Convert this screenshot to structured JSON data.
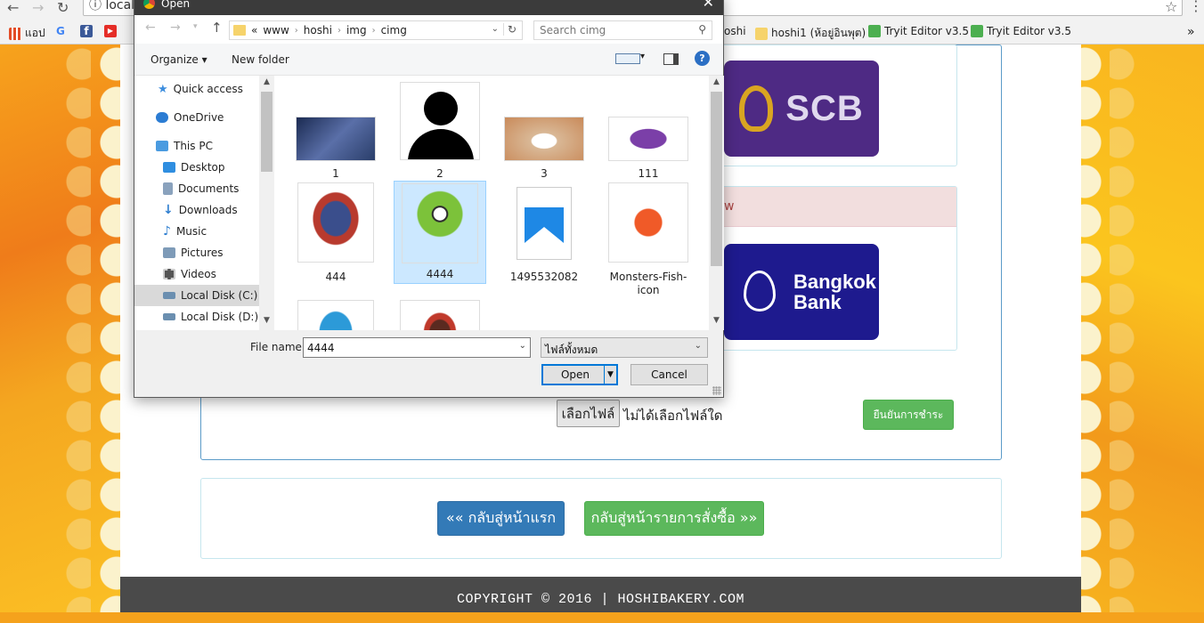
{
  "browser": {
    "address_text": "local",
    "back_glyph": "←",
    "forward_glyph": "→",
    "reload_glyph": "↻",
    "info_glyph": "ⓘ",
    "star_glyph": "☆",
    "menu_glyph": "⋮",
    "bookmarks": [
      {
        "label": "แอป",
        "icon": "apps-icon",
        "color": "#e34c26"
      },
      {
        "label": "G",
        "icon": "google-icon",
        "color": "#4285f4"
      },
      {
        "label": "f",
        "icon": "facebook-icon",
        "color": "#3b5998"
      },
      {
        "label": "▶",
        "icon": "youtube-icon",
        "color": "#e52d27"
      },
      {
        "label": "oshi",
        "icon": "",
        "color": ""
      },
      {
        "label": "hoshi1 (ห้อยู่อินพุต)",
        "icon": "folder-icon",
        "color": "#f6d36b"
      },
      {
        "label": "Tryit Editor v3.5",
        "icon": "w3schools-icon",
        "color": "#4caf50"
      },
      {
        "label": "Tryit Editor v3.5",
        "icon": "w3schools-icon",
        "color": "#4caf50"
      }
    ],
    "more_bookmarks_glyph": "»"
  },
  "page": {
    "banks": [
      {
        "name": "SCB",
        "color": "#4e2a84"
      },
      {
        "name_line1": "Bangkok",
        "name_line2": "Bank",
        "color": "#1e1a8e"
      }
    ],
    "alert_fragment": "w",
    "alert_color": "#f2dede",
    "file_button_label": "เลือกไฟล์",
    "no_file_label": "ไม่ได้เลือกไฟล์ใด",
    "confirm_button_label": "ยืนยันการชำระ",
    "back_home_button_label": "«« กลับสู่หน้าแรก",
    "back_orders_button_label": "กลับสู่หน้ารายการสั่งซื้อ »»",
    "primary_color": "#337ab7",
    "success_color": "#5cb85c",
    "footer_text": "COPYRIGHT © 2016 | HOSHIBAKERY.COM"
  },
  "dialog": {
    "title": "Open",
    "close_glyph": "✕",
    "path_prefix": "«",
    "path": [
      "www",
      "hoshi",
      "img",
      "cimg"
    ],
    "search_placeholder": "Search cimg",
    "organize_label": "Organize ▾",
    "new_folder_label": "New folder",
    "help_glyph": "?",
    "nav_items": [
      {
        "label": "Quick access",
        "icon": "star-icon",
        "color": "#3c8dde"
      },
      {
        "label": "OneDrive",
        "icon": "cloud-icon",
        "color": "#2b7cd3"
      },
      {
        "label": "This PC",
        "icon": "computer-icon",
        "color": "#4a9be0"
      },
      {
        "label": "Desktop",
        "icon": "desktop-icon",
        "color": "#2f8ee0"
      },
      {
        "label": "Documents",
        "icon": "documents-icon",
        "color": "#8aa2bd"
      },
      {
        "label": "Downloads",
        "icon": "download-icon",
        "color": "#2f7fd0"
      },
      {
        "label": "Music",
        "icon": "music-icon",
        "color": "#2f7fd0"
      },
      {
        "label": "Pictures",
        "icon": "pictures-icon",
        "color": "#7e9bb8"
      },
      {
        "label": "Videos",
        "icon": "videos-icon",
        "color": "#555555"
      },
      {
        "label": "Local Disk (C:)",
        "icon": "disk-icon",
        "color": "#6b8fb0"
      },
      {
        "label": "Local Disk (D:)",
        "icon": "disk-icon",
        "color": "#6b8fb0"
      }
    ],
    "files": [
      {
        "name": "1",
        "icon": "photo-man-icon",
        "color": "#2a3e6a"
      },
      {
        "name": "2",
        "icon": "user-silhouette-icon",
        "color": "#000000"
      },
      {
        "name": "3",
        "icon": "photo-cat-icon",
        "color": "#d9b896"
      },
      {
        "name": "111",
        "icon": "monster-purple-icon",
        "color": "#7b3fa8"
      },
      {
        "name": "444",
        "icon": "monster-blue-icon",
        "color": "#3a4e8c"
      },
      {
        "name": "4444",
        "icon": "monster-green-icon",
        "color": "#7cc23a"
      },
      {
        "name": "1495532082",
        "icon": "image-file-icon",
        "color": "#1e88e5"
      },
      {
        "name": "Monsters-Fish-icon",
        "icon": "monster-orange-icon",
        "color": "#f05a28"
      },
      {
        "name": "",
        "icon": "monster-sulley-icon",
        "color": "#2c9ad8"
      },
      {
        "name": "",
        "icon": "character-dark-icon",
        "color": "#5a2a20"
      }
    ],
    "file_name_label": "File name:",
    "file_name_value": "4444",
    "file_type_value": "ไฟล์ทั้งหมด",
    "open_label": "Open",
    "cancel_label": "Cancel"
  }
}
